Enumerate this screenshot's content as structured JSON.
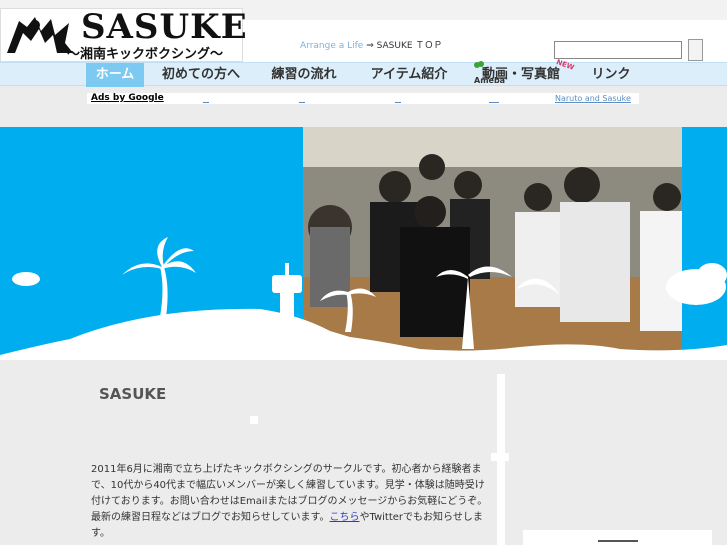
{
  "logo": {
    "brand": "SASUKE",
    "tagline": "〜湘南キックボクシング〜"
  },
  "breadcrumb": {
    "site": "Arrange a Life",
    "arrow": "⇒",
    "current": "SASUKE ＴＯＰ"
  },
  "search": {
    "value": "",
    "placeholder": ""
  },
  "nav": {
    "items": [
      {
        "label": "ホーム"
      },
      {
        "label": "初めての方へ"
      },
      {
        "label": "練習の流れ"
      },
      {
        "label": "アイテム紹介"
      },
      {
        "label": "動画・写真館"
      },
      {
        "label": "リンク"
      }
    ],
    "ameba_label": "Ameba",
    "new_badge": "NEW"
  },
  "ads": {
    "label": "Ads by Google",
    "link": "Naruto and Sasuke"
  },
  "main": {
    "title": "SASUKE",
    "paragraph": "2011年6月に湘南で立ち上げたキックボクシングのサークルです。初心者から経験者まで、10代から40代まで幅広いメンバーが楽しく練習しています。見学・体験は随時受け付けております。お問い合わせはEmailまたはブログのメッセージからお気軽にどうぞ。最新の練習日程などはブログでお知らせしています。",
    "more_link": "こちら",
    "paragraph_tail": "やTwitterでもお知らせします。"
  },
  "colors": {
    "nav_bg": "#dbeefa",
    "nav_active": "#7cc9f1",
    "hero_bg": "#00adef",
    "link": "#2a3fc0"
  }
}
